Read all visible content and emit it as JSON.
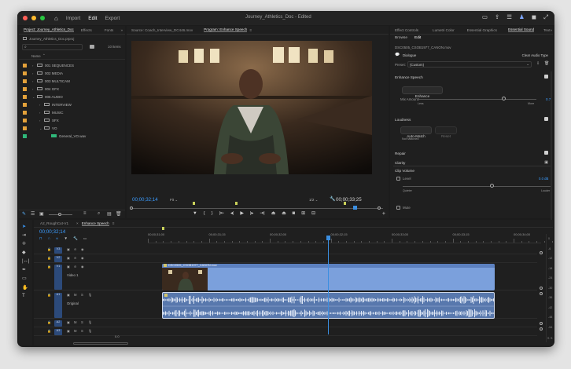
{
  "titlebar": {
    "tabs": [
      "Import",
      "Edit",
      "Export"
    ],
    "active_tab": "Edit",
    "title": "Journey_Athletics_Doc - Edited",
    "icons": [
      "workspace-icon",
      "share-icon",
      "panel-icon",
      "user-icon",
      "comment-icon",
      "fullscreen-icon"
    ]
  },
  "project": {
    "tabs": [
      "Project: Journey_Athletics_Doc",
      "Effects",
      "Fonts"
    ],
    "file": "Journey_Athletics_Doc.prproj",
    "count": "10 items",
    "column": "Name",
    "items": [
      {
        "label": "001 SEQUENCES",
        "color": "#e3a13a",
        "level": 0,
        "open": false
      },
      {
        "label": "002 MEDIA",
        "color": "#e3a13a",
        "level": 0,
        "open": false
      },
      {
        "label": "003 MULTICAM",
        "color": "#e3a13a",
        "level": 0,
        "open": false
      },
      {
        "label": "004 GFX",
        "color": "#e3a13a",
        "level": 0,
        "open": false
      },
      {
        "label": "005 AUDIO",
        "color": "#e3a13a",
        "level": 0,
        "open": true
      },
      {
        "label": "INTERVIEW",
        "color": "#e3a13a",
        "level": 1,
        "open": false
      },
      {
        "label": "MUSIC",
        "color": "#e3a13a",
        "level": 1,
        "open": false
      },
      {
        "label": "SFX",
        "color": "#e3a13a",
        "level": 1,
        "open": false
      },
      {
        "label": "VO",
        "color": "#e3a13a",
        "level": 1,
        "open": true
      },
      {
        "label": "General_VO.wav",
        "color": "#2fb87a",
        "level": 2,
        "open": false
      }
    ]
  },
  "source_monitor": {
    "tabs": [
      "Source: Coach_Interview_DC446.mov",
      "Program: Enhance Speech"
    ],
    "timecode": "00;00;32;14",
    "fit": "Fit",
    "ratio": "1/2",
    "duration": "00;00;33;25"
  },
  "essential_sound": {
    "tabs": [
      "Effect Controls",
      "Lumetri Color",
      "Essential Graphics",
      "Essential Sound",
      "Text"
    ],
    "subtabs": [
      "Browse",
      "Edit"
    ],
    "clip": "DSC0505_CSOB1977_CANON.mov",
    "type": "Dialogue",
    "clear_label": "Clear Audio Type",
    "preset_label": "Preset:",
    "preset_value": "(Custom)",
    "enhance_title": "Enhance Speech",
    "enhance_button": "Enhance",
    "mix_label": "Mix Amount:",
    "mix_min": "Less",
    "mix_max": "More",
    "mix_value": "0.7",
    "mix_level": 0.72,
    "loudness_title": "Loudness",
    "auto_match": "Auto-Match",
    "reset": "Reset",
    "not_matched": "Not Matched",
    "repair_title": "Repair",
    "clarity_title": "Clarity",
    "clip_volume_title": "Clip Volume",
    "level_label": "Level",
    "level_value": "0.0 dB",
    "level_quieter": "Quieter",
    "level_louder": "Louder",
    "level_level": 0.6,
    "mute_label": "Mute"
  },
  "timeline": {
    "tabs": [
      "A2_RoughCut-V1",
      "Enhance Speech"
    ],
    "timecode": "00;00;32;14",
    "ruler": [
      "00;00;31;00",
      "00;00;31;15",
      "00;00;32;00",
      "00;00;32;15",
      "00;00;33;00",
      "00;00;33;15",
      "00;00;34;00"
    ],
    "tracks": [
      {
        "name": "V3",
        "label": ""
      },
      {
        "name": "V2",
        "label": ""
      },
      {
        "name": "V1",
        "label": "Video 1"
      },
      {
        "name": "A1",
        "label": "Original"
      },
      {
        "name": "A2",
        "label": ""
      },
      {
        "name": "A3",
        "label": ""
      }
    ],
    "track_letters": [
      "M",
      "S"
    ],
    "clip_name": "DSC0505_CSOB1977_CANON.mov",
    "master": "0.0",
    "meter_scale": [
      "0",
      "-6",
      "-12",
      "-18",
      "-24",
      "-30",
      "-36",
      "-42",
      "-48",
      "-54"
    ],
    "meter_labels": [
      "S",
      "S"
    ]
  },
  "colors": {
    "accent": "#3b8ee0",
    "video_clip": "#7ba0dc",
    "audio_clip": "#5878ad",
    "folder": "#e3a13a",
    "file": "#2fb87a"
  }
}
